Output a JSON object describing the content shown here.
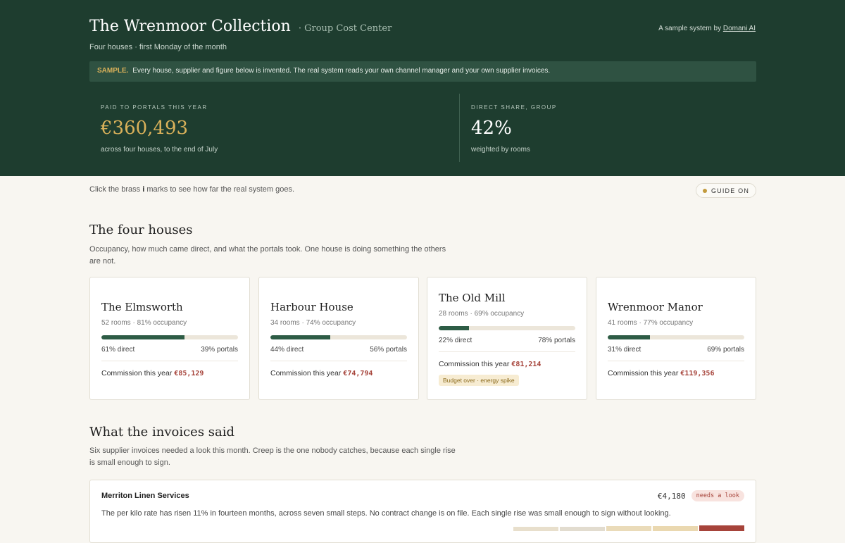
{
  "header": {
    "title": "The Wrenmoor Collection",
    "subtitle": "· Group Cost Center",
    "credit_prefix": "A sample system by",
    "credit_link": "Domani AI",
    "tagline": "Four houses · first Monday of the month"
  },
  "banner": {
    "tag": "SAMPLE.",
    "text": "Every house, supplier and figure below is invented. The real system reads your own channel manager and your own supplier invoices."
  },
  "stats": {
    "left": {
      "label": "PAID TO PORTALS THIS YEAR",
      "value": "€360,493",
      "note": "across four houses, to the end of July"
    },
    "right": {
      "label": "DIRECT SHARE, GROUP",
      "value": "42%",
      "note": "weighted by rooms"
    }
  },
  "guide": {
    "help_prefix": "Click the brass",
    "help_mark": "i",
    "help_suffix": "marks to see how far the real system goes.",
    "pill_label": "GUIDE ON"
  },
  "houses_section": {
    "title": "The four houses",
    "desc": "Occupancy, how much came direct, and what the portals took. One house is doing something the others are not."
  },
  "houses": [
    {
      "name": "The Elmsworth",
      "meta": "52 rooms · 81% occupancy",
      "direct_pct": 61,
      "direct": "61% direct",
      "portals": "39% portals",
      "commission_label": "Commission this year",
      "commission": "€85,129"
    },
    {
      "name": "Harbour House",
      "meta": "34 rooms · 74% occupancy",
      "direct_pct": 44,
      "direct": "44% direct",
      "portals": "56% portals",
      "commission_label": "Commission this year",
      "commission": "€74,794"
    },
    {
      "name": "The Old Mill",
      "meta": "28 rooms · 69% occupancy",
      "direct_pct": 22,
      "direct": "22% direct",
      "portals": "78% portals",
      "commission_label": "Commission this year",
      "commission": "€81,214",
      "flag": "Budget over · energy spike"
    },
    {
      "name": "Wrenmoor Manor",
      "meta": "41 rooms · 77% occupancy",
      "direct_pct": 31,
      "direct": "31% direct",
      "portals": "69% portals",
      "commission_label": "Commission this year",
      "commission": "€119,356"
    }
  ],
  "invoices_section": {
    "title": "What the invoices said",
    "desc": "Six supplier invoices needed a look this month. Creep is the one nobody catches, because each single rise is small enough to sign."
  },
  "invoice": {
    "supplier": "Merriton Linen Services",
    "amount": "€4,180",
    "badge": "needs a look",
    "desc": "The per kilo rate has risen 11% in fourteen months, across seven small steps. No contract change is on file. Each single rise was small enough to sign without looking."
  },
  "colors": {
    "hero_bg": "#1e3d2f",
    "accent_brass": "#d9b15a",
    "bar_fill": "#2d5c45",
    "commission_red": "#a6433a"
  }
}
